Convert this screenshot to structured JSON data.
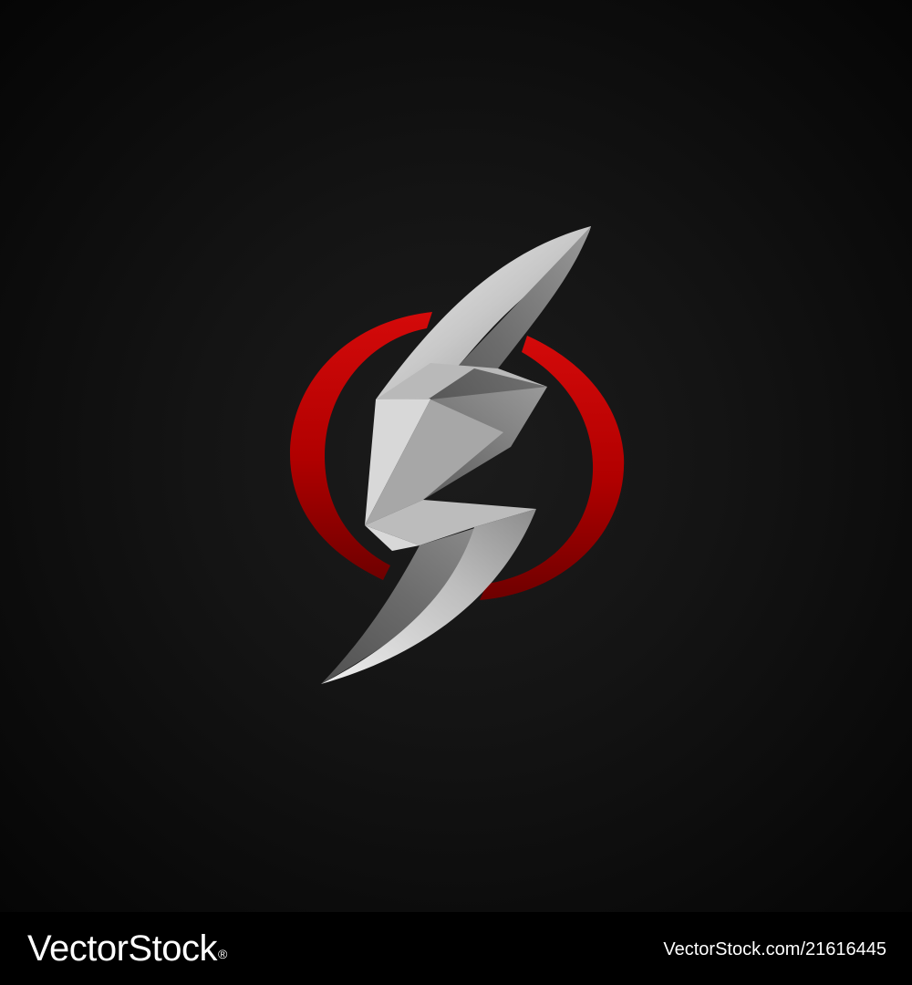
{
  "artwork": {
    "logo_icon": "lightning-bolt-in-red-circle",
    "colors": {
      "background": "#141414",
      "ring_red": "#c00000",
      "ring_dark_red": "#7a0000",
      "bolt_silver_light": "#e6e6e6",
      "bolt_silver_dark": "#6a6a6a"
    }
  },
  "footer": {
    "brand_name": "VectorStock",
    "brand_mark": "®",
    "image_id": "VectorStock.com/21616445"
  }
}
